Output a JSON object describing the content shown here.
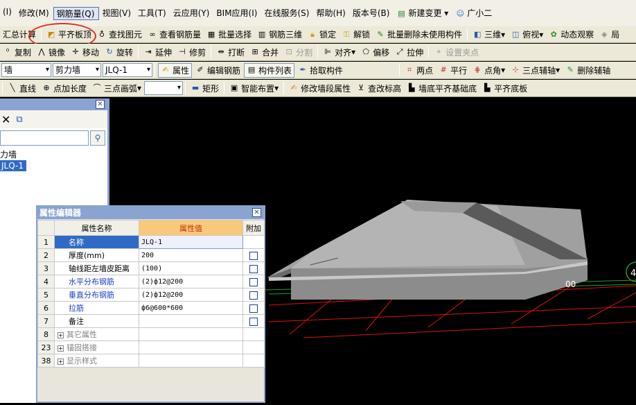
{
  "menu": [
    "(I)",
    "修改(M)",
    "钢筋量(Q)",
    "视图(V)",
    "工具(T)",
    "云应用(Y)",
    "BIM应用(I)",
    "在线服务(S)",
    "帮助(H)",
    "版本号(B)",
    "新建变更",
    "广小二"
  ],
  "toolbar1": [
    "汇总计算",
    "平齐板顶",
    "查找图元",
    "查看钢筋量",
    "批量选择",
    "钢筋三维",
    "锁定",
    "解锁",
    "批量删除未使用构件",
    "三维",
    "俯视",
    "动态观察",
    "局"
  ],
  "toolbar2": [
    "复制",
    "镜像",
    "移动",
    "旋转",
    "延伸",
    "修剪",
    "打断",
    "合并",
    "分割",
    "对齐",
    "偏移",
    "拉伸",
    "设置夹点"
  ],
  "toolbar3": {
    "drop1": "墙",
    "drop2": "剪力墙",
    "drop3": "JLQ-1",
    "buttons": [
      "属性",
      "编辑钢筋",
      "构件列表",
      "拾取构件",
      "两点",
      "平行",
      "点角",
      "三点辅轴",
      "删除辅轴"
    ]
  },
  "toolbar4": [
    "直线",
    "点加长度",
    "三点画弧",
    "矩形",
    "智能布置",
    "修改墙段属性",
    "查改标高",
    "墙底平齐基础底",
    "平齐底板"
  ],
  "tree": {
    "parent": "力墙",
    "child": "JLQ-1"
  },
  "props": {
    "title": "属性编辑器",
    "headers": [
      "属性名称",
      "属性值",
      "附加"
    ],
    "rows": [
      {
        "idx": "1",
        "name": "名称",
        "value": "JLQ-1",
        "style": "sel",
        "check": false
      },
      {
        "idx": "2",
        "name": "厚度(mm)",
        "value": "200",
        "style": "",
        "check": true
      },
      {
        "idx": "3",
        "name": "轴线距左墙皮距离",
        "value": "(100)",
        "style": "",
        "check": true
      },
      {
        "idx": "4",
        "name": "水平分布钢筋",
        "value": "(2)ф12@200",
        "style": "blue",
        "check": true
      },
      {
        "idx": "5",
        "name": "垂直分布钢筋",
        "value": "(2)ф12@200",
        "style": "blue",
        "check": true
      },
      {
        "idx": "6",
        "name": "拉筋",
        "value": "ф6@600*600",
        "style": "blue",
        "check": true
      },
      {
        "idx": "7",
        "name": "备注",
        "value": "",
        "style": "",
        "check": true
      },
      {
        "idx": "8",
        "name": "其它属性",
        "value": "",
        "style": "grey",
        "check": false,
        "expand": true
      },
      {
        "idx": "23",
        "name": "锚固搭接",
        "value": "",
        "style": "grey",
        "check": false,
        "expand": true
      },
      {
        "idx": "38",
        "name": "显示样式",
        "value": "",
        "style": "grey",
        "check": false,
        "expand": true
      }
    ]
  },
  "viewport": {
    "dim_label": "00",
    "right_label": "4"
  }
}
